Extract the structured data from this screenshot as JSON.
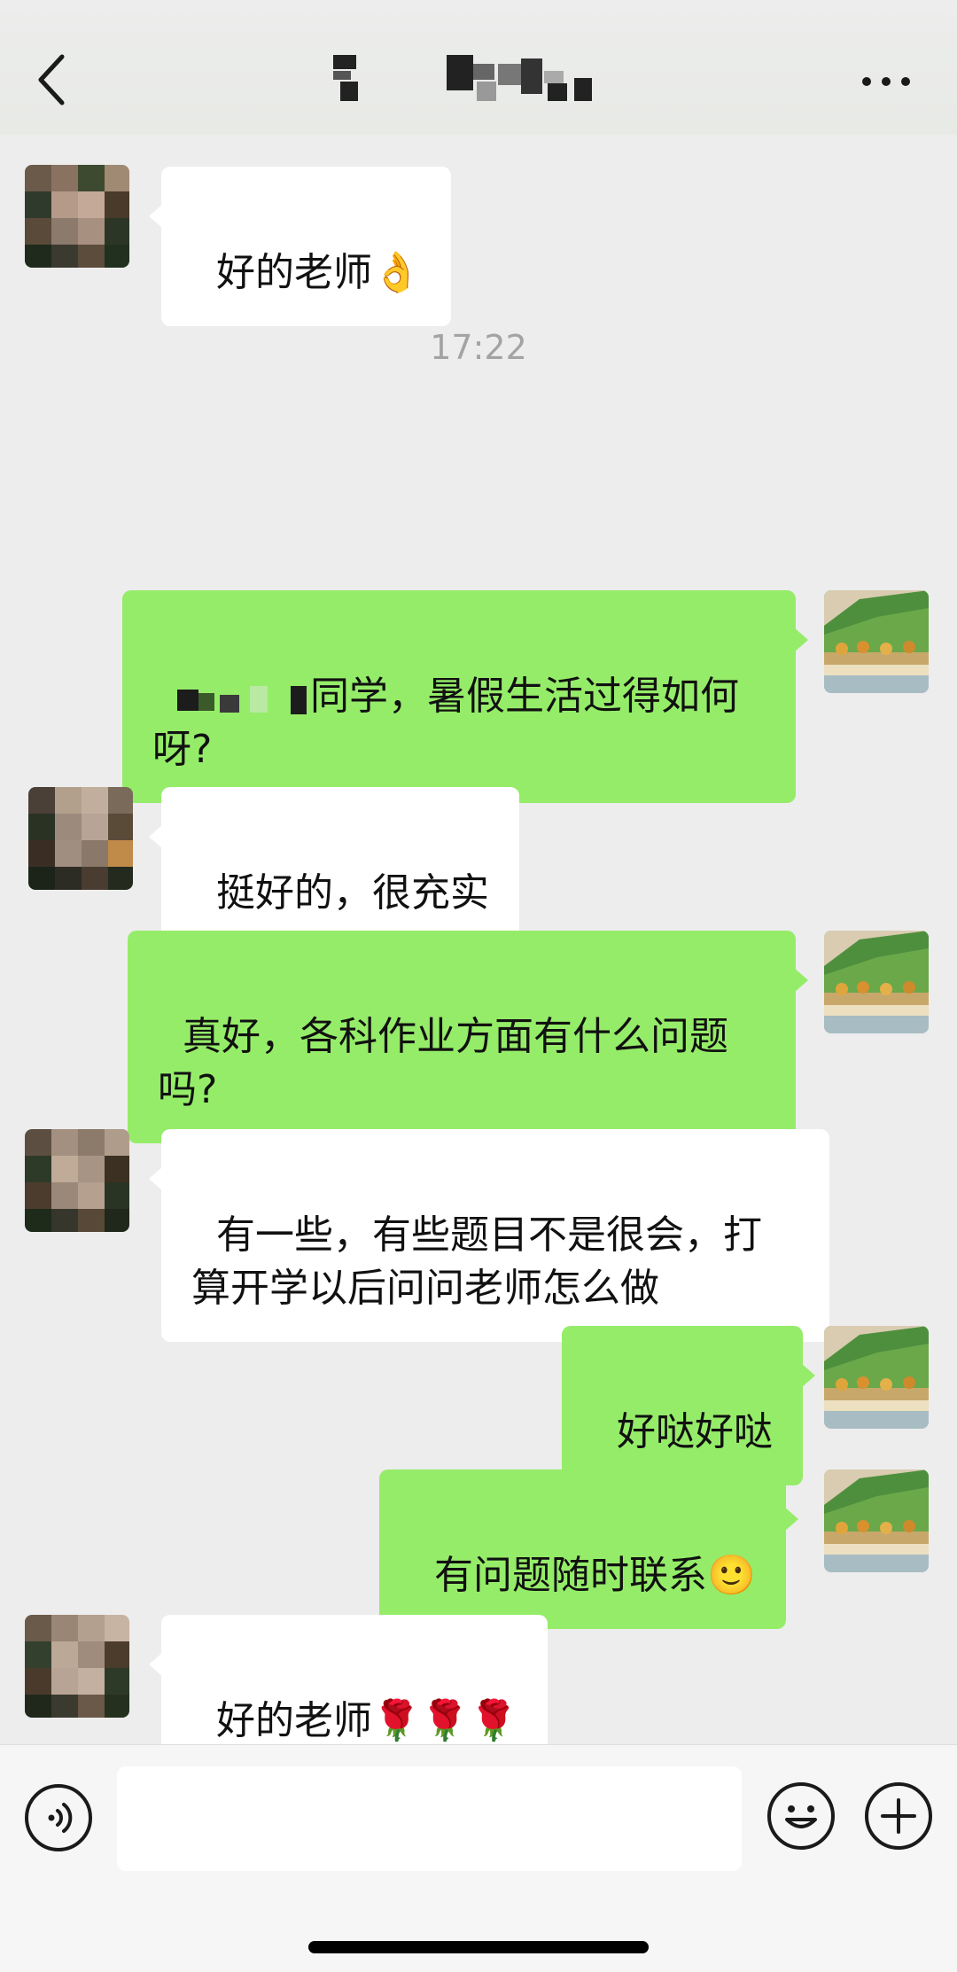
{
  "header": {
    "title": "",
    "back_icon": "chevron-left-icon",
    "more_icon": "ellipsis-icon"
  },
  "timestamp": "17:22",
  "messages": [
    {
      "side": "left",
      "text": "好的老师",
      "emoji": "👌"
    },
    {
      "side": "right",
      "text": "同学，暑假生活过得如何\n呀?",
      "prefix_redacted": true
    },
    {
      "side": "left",
      "text": "挺好的，很充实"
    },
    {
      "side": "right",
      "text": "真好，各科作业方面有什么问题\n吗?"
    },
    {
      "side": "left",
      "text": "有一些，有些题目不是很会，打\n算开学以后问问老师怎么做"
    },
    {
      "side": "right",
      "text": "好哒好哒"
    },
    {
      "side": "right",
      "text": "有问题随时联系",
      "emoji": "🙂"
    },
    {
      "side": "left",
      "text": "好的老师",
      "emoji": "🌹🌹🌹"
    }
  ],
  "input_bar": {
    "placeholder": "",
    "voice_icon": "voice-icon",
    "emoji_icon": "smiley-icon",
    "plus_icon": "plus-icon"
  },
  "colors": {
    "background": "#ededed",
    "bubble_left": "#ffffff",
    "bubble_right": "#95ec69"
  }
}
